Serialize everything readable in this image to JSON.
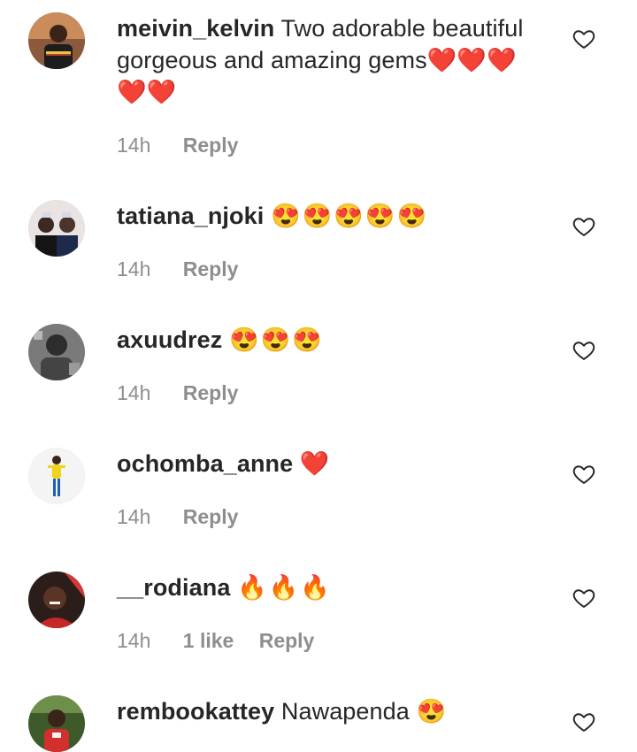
{
  "colors": {
    "primary_text": "#262626",
    "secondary_text": "#8e8e8e",
    "heart_red": "#e0141e",
    "background": "#ffffff"
  },
  "comments": [
    {
      "username": "meivin_kelvin",
      "text": "Two adorable beautiful gorgeous and amazing gems❤️❤️❤️❤️❤️",
      "time": "14h",
      "likes": "",
      "reply": "Reply",
      "like_icon": "heart-outline-icon"
    },
    {
      "username": "tatiana_njoki",
      "text": "😍😍😍😍😍",
      "time": "14h",
      "likes": "",
      "reply": "Reply",
      "like_icon": "heart-outline-icon"
    },
    {
      "username": "axuudrez",
      "text": "😍😍😍",
      "time": "14h",
      "likes": "",
      "reply": "Reply",
      "like_icon": "heart-outline-icon"
    },
    {
      "username": "ochomba_anne",
      "text": "❤️",
      "time": "14h",
      "likes": "",
      "reply": "Reply",
      "like_icon": "heart-outline-icon"
    },
    {
      "username": "__rodiana",
      "text": "🔥🔥🔥",
      "time": "14h",
      "likes": "1 like",
      "reply": "Reply",
      "like_icon": "heart-outline-icon"
    },
    {
      "username": "rembookattey",
      "text": "Nawapenda 😍",
      "time": "",
      "likes": "",
      "reply": "",
      "like_icon": "heart-outline-icon"
    }
  ]
}
